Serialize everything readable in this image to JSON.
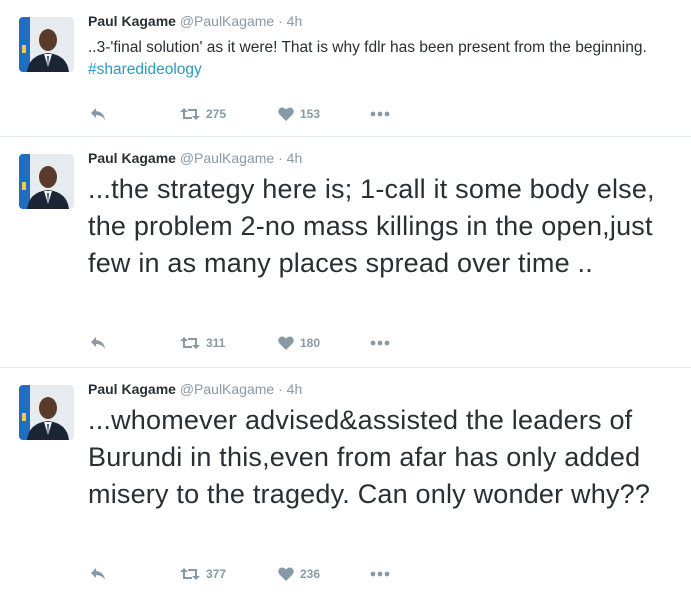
{
  "tweets": [
    {
      "name": "Paul Kagame",
      "handle": "@PaulKagame",
      "sep": "·",
      "time": "4h",
      "text": "..3-'final solution' as it were! That is why fdlr has been present from the beginning. ",
      "hashtag": "#sharedideology",
      "retweets": "275",
      "likes": "153",
      "icons": {
        "reply": "reply-icon",
        "retweet": "retweet-icon",
        "like": "heart-icon",
        "more": "more-icon"
      }
    },
    {
      "name": "Paul Kagame",
      "handle": "@PaulKagame",
      "sep": "·",
      "time": "4h",
      "text": "...the strategy here is; 1-call it some body else, the problem 2-no mass killings in the open,just few in as many places spread over time ..",
      "retweets": "311",
      "likes": "180"
    },
    {
      "name": "Paul Kagame",
      "handle": "@PaulKagame",
      "sep": "·",
      "time": "4h",
      "text": "...whomever advised&assisted the leaders of Burundi in this,even from afar has only added misery to the tragedy. Can only wonder why??",
      "retweets": "377",
      "likes": "236"
    }
  ],
  "colors": {
    "name": "#292f33",
    "meta": "#8899a6",
    "hashtag": "#2b9bbc",
    "divider": "#e1e8ed",
    "avatar_bg": "#e8edf2",
    "flag_blue": "#1e6fc2"
  }
}
